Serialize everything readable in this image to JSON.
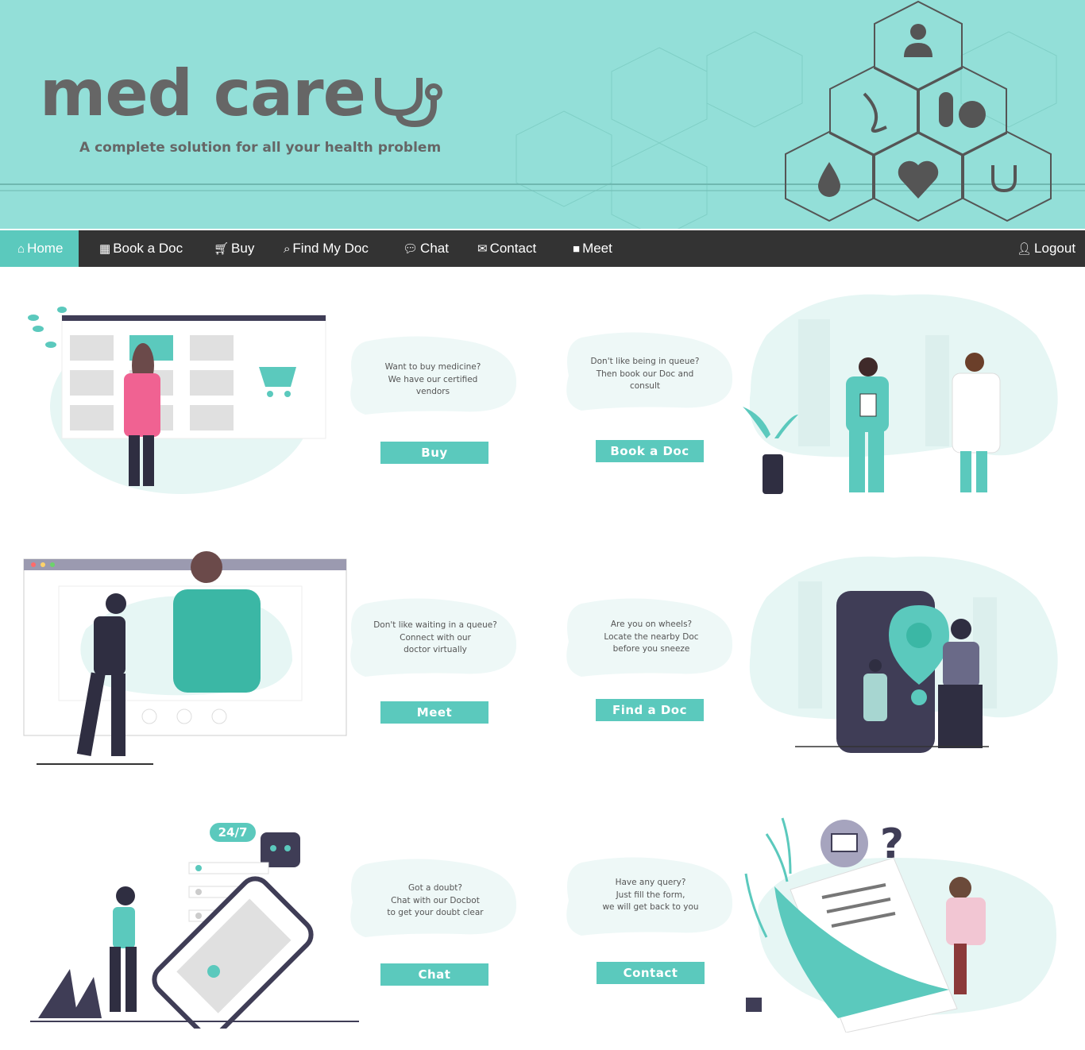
{
  "header": {
    "brand": "med care",
    "tagline": "A complete solution for all your health problem"
  },
  "nav": {
    "items": [
      {
        "label": "Home",
        "icon": "home-icon"
      },
      {
        "label": "Book a Doc",
        "icon": "calendar-icon"
      },
      {
        "label": "Buy",
        "icon": "cart-icon"
      },
      {
        "label": "Find My Doc",
        "icon": "search-icon"
      },
      {
        "label": "Chat",
        "icon": "chat-icon"
      },
      {
        "label": "Contact",
        "icon": "envelope-icon"
      },
      {
        "label": "Meet",
        "icon": "video-icon"
      }
    ],
    "logout": "Logout"
  },
  "cards": {
    "buy": {
      "text": [
        "Want to buy medicine?",
        "We have our certified",
        "vendors"
      ],
      "button": "Buy"
    },
    "book": {
      "text": [
        "Don't like being in queue?",
        "Then book our Doc and",
        "consult"
      ],
      "button": "Book a Doc"
    },
    "meet": {
      "text": [
        "Don't like waiting in a queue?",
        "Connect with our",
        "doctor virtually"
      ],
      "button": "Meet"
    },
    "find": {
      "text": [
        "Are you on wheels?",
        "Locate the nearby Doc",
        "before you sneeze"
      ],
      "button": "Find a Doc"
    },
    "chat": {
      "text": [
        "Got a doubt?",
        "Chat with our Docbot",
        "to get your doubt clear"
      ],
      "button": "Chat"
    },
    "contact": {
      "text": [
        "Have any query?",
        "Just fill the form,",
        "we will get back to you"
      ],
      "button": "Contact"
    }
  },
  "illustration_labels": {
    "chat_badge": "24/7"
  },
  "colors": {
    "header_bg": "#93dfd8",
    "accent": "#5bc9bd",
    "nav_bg": "#333333",
    "brand_text": "#666666"
  }
}
